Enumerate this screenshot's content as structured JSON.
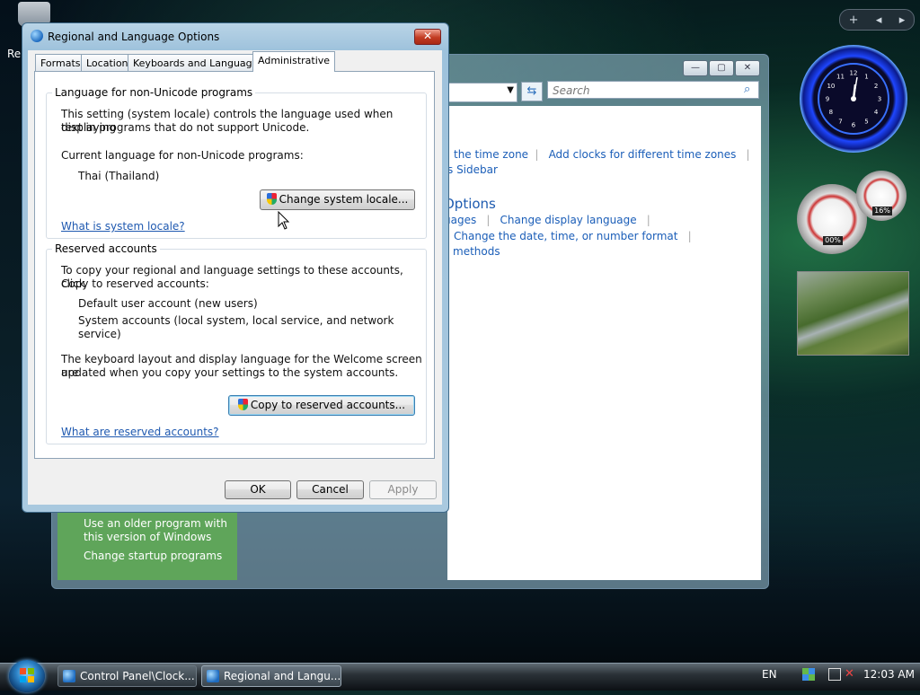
{
  "desktop": {
    "recycle_label": "Re"
  },
  "sidebar": {
    "controls": [
      "+",
      "◂",
      "▸"
    ],
    "clock_numbers": [
      "12",
      "1",
      "2",
      "3",
      "4",
      "5",
      "6",
      "7",
      "8",
      "9",
      "10",
      "11"
    ],
    "cpu_value": "00%",
    "ram_value": "16%"
  },
  "control_panel": {
    "search_placeholder": "Search",
    "window_buttons": [
      "—",
      "▢",
      "✕"
    ],
    "links_row1": [
      "the time zone",
      "Add clocks for different time zones"
    ],
    "links_row1b": "s Sidebar",
    "heading": "Options",
    "links_row2": [
      "uages",
      "Change display language"
    ],
    "links_row3": "Change the date, time, or number format",
    "links_row4": "methods",
    "left_items": [
      "Use an older program with this version of Windows",
      "Change startup programs"
    ]
  },
  "dialog": {
    "title": "Regional and Language Options",
    "close_label": "✕",
    "tabs": [
      "Formats",
      "Location",
      "Keyboards and Languages",
      "Administrative"
    ],
    "active_tab": "Administrative",
    "group1": {
      "label": "Language for non-Unicode programs",
      "desc1": "This setting (system locale) controls the language used when displaying",
      "desc2": "text in programs that do not support Unicode.",
      "current_label": "Current language for non-Unicode programs:",
      "current_value": "Thai (Thailand)",
      "button": "Change system locale...",
      "link": "What is system locale?"
    },
    "group2": {
      "label": "Reserved accounts",
      "desc1": "To copy your regional and language settings to these accounts, click",
      "desc2": "Copy to reserved accounts:",
      "item1": "Default user account (new users)",
      "item2": "System accounts (local system, local service, and network service)",
      "desc3": "The keyboard layout and display language for the Welcome screen are",
      "desc4": "updated when you copy your settings to the system accounts.",
      "button": "Copy to reserved accounts...",
      "link": "What are reserved accounts?"
    },
    "buttons": {
      "ok": "OK",
      "cancel": "Cancel",
      "apply": "Apply"
    }
  },
  "taskbar": {
    "items": [
      "Control Panel\\Clock...",
      "Regional and Langu..."
    ],
    "language": "EN",
    "time": "12:03 AM"
  }
}
